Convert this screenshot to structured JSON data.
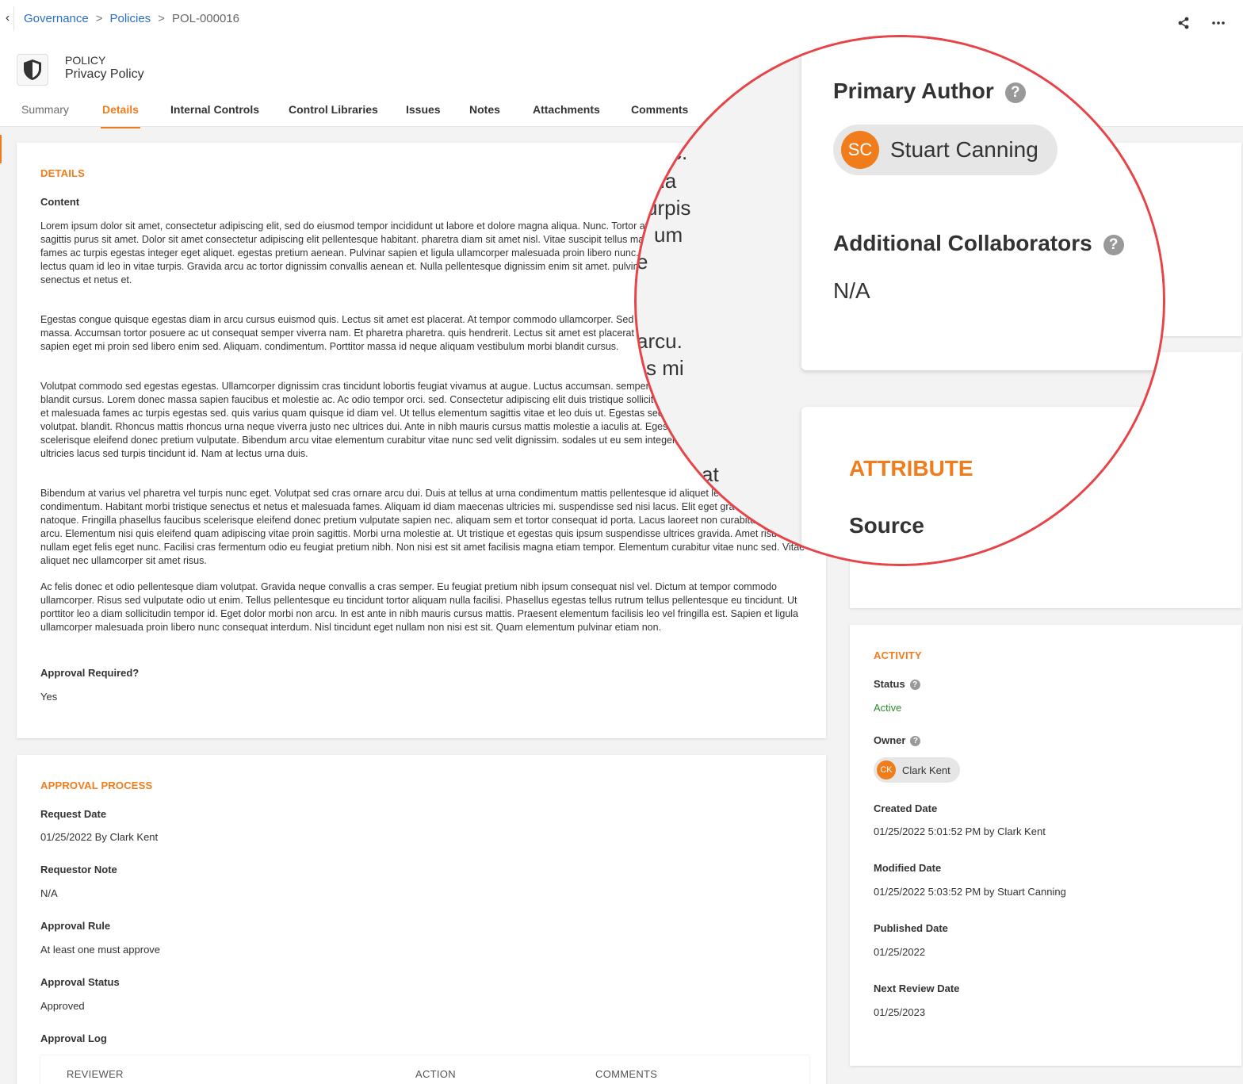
{
  "breadcrumb": {
    "item1": "Governance",
    "item2": "Policies",
    "current": "POL-000016"
  },
  "record": {
    "type": "POLICY",
    "name": "Privacy Policy"
  },
  "tabs": [
    "Summary",
    "Details",
    "Internal Controls",
    "Control Libraries",
    "Issues",
    "Notes",
    "Attachments",
    "Comments"
  ],
  "details": {
    "title": "DETAILS",
    "content_label": "Content",
    "paragraphs": [
      "Lorem ipsum dolor sit amet, consectetur adipiscing elit, sed do eiusmod tempor incididunt ut labore et dolore magna aliqua. Nunc. Tortor at risus viverra adipiscing at. Quisque sagittis purus sit amet. Dolor sit amet consectetur adipiscing elit pellentesque habitant. pharetra diam sit amet nisl. Vitae suscipit tellus mauris a diam maecenas. Malesuada fames ac turpis egestas integer eget aliquet. egestas pretium aenean. Pulvinar sapien et ligula ullamcorper malesuada proin libero nunc. Eu nisl nunc mi ipsum faucibus vitae. lectus quam id leo in vitae turpis. Gravida arcu ac tortor dignissim convallis aenean et. Nulla pellentesque dignissim enim sit amet. pulvinar pellentesque habitant morbi tristique senectus et netus et.",
      "Egestas congue quisque egestas diam in arcu cursus euismod quis. Lectus sit amet est placerat. At tempor commodo ullamcorper. Sed ullamcorper morbi tincidunt ornare massa. Accumsan tortor posuere ac ut consequat semper viverra nam. Et pharetra pharetra. quis hendrerit. Lectus sit amet est placerat in egestas erat imperdiet. Ultrices dui sapien eget mi proin sed libero enim sed. Aliquam. condimentum. Porttitor massa id neque aliquam vestibulum morbi blandit cursus.",
      "Volutpat commodo sed egestas egestas. Ullamcorper dignissim cras tincidunt lobortis feugiat vivamus at augue. Luctus accumsan. semper viverra. Aliquam vestibulum morbi blandit cursus. Lorem donec massa sapien faucibus et molestie ac. Ac odio tempor orci. sed. Consectetur adipiscing elit duis tristique sollicitudin nibh sit amet commodo. Netus et malesuada fames ac turpis egestas sed. quis varius quam quisque id diam vel. Ut tellus elementum sagittis vitae et leo duis ut. Egestas sed tempus urna et. Enim blandit volutpat. blandit. Rhoncus mattis rhoncus urna neque viverra justo nec ultrices dui. Ante in nibh mauris cursus mattis molestie a iaculis at. Egestas. phasellus faucibus scelerisque eleifend donec pretium vulputate. Bibendum arcu vitae elementum curabitur vitae nunc sed velit dignissim. sodales ut eu sem integer vitae justo. Placerat duis ultricies lacus sed turpis tincidunt id. Nam at lectus urna duis.",
      "Bibendum at varius vel pharetra vel turpis nunc eget. Volutpat sed cras ornare arcu dui. Duis at tellus at urna condimentum mattis pellentesque id aliquet lectus proin nibh nisl condimentum. Habitant morbi tristique senectus et netus et malesuada fames. Aliquam id diam maecenas ultricies mi. suspendisse sed nisi lacus. Elit eget gravida cum sociis natoque. Fringilla phasellus faucibus scelerisque eleifend donec pretium vulputate sapien nec. aliquam sem et tortor consequat id porta. Lacus laoreet non curabitur gravida arcu. Elementum nisi quis eleifend quam adipiscing vitae proin sagittis. Morbi urna molestie at. Ut tristique et egestas quis ipsum suspendisse ultrices gravida. Amet risus nullam eget felis eget nunc. Facilisi cras fermentum odio eu feugiat pretium nibh. Non nisi est sit amet facilisis magna etiam tempor. Elementum curabitur vitae nunc sed. Vitae aliquet nec ullamcorper sit amet risus.",
      "Ac felis donec et odio pellentesque diam volutpat. Gravida neque convallis a cras semper. Eu feugiat pretium nibh ipsum consequat nisl vel. Dictum at tempor commodo ullamcorper. Risus sed vulputate odio ut enim. Tellus pellentesque eu tincidunt tortor aliquam nulla facilisi. Phasellus egestas tellus rutrum tellus pellentesque eu tincidunt. Ut porttitor leo a diam sollicitudin tempor id. Eget dolor morbi non arcu. In est ante in nibh mauris cursus mattis. Praesent elementum facilisis leo vel fringilla est. Sapien et ligula ullamcorper malesuada proin libero nunc consequat interdum. Nisl tincidunt eget nullam non nisi est sit. Quam elementum pulvinar etiam non."
    ],
    "approval_required_label": "Approval Required?",
    "approval_required_value": "Yes"
  },
  "approval": {
    "title": "APPROVAL PROCESS",
    "request_date_label": "Request Date",
    "request_date_value": "01/25/2022 By Clark Kent",
    "requestor_note_label": "Requestor Note",
    "requestor_note_value": "N/A",
    "rule_label": "Approval Rule",
    "rule_value": "At least one must approve",
    "status_label": "Approval Status",
    "status_value": "Approved",
    "log_label": "Approval Log",
    "log_columns": [
      "REVIEWER",
      "ACTION",
      "COMMENTS"
    ]
  },
  "activity": {
    "title": "ACTIVITY",
    "status_label": "Status",
    "status_value": "Active",
    "owner_label": "Owner",
    "owner_initials": "CK",
    "owner_name": "Clark Kent",
    "created_label": "Created Date",
    "created_value": "01/25/2022 5:01:52 PM by Clark Kent",
    "modified_label": "Modified Date",
    "modified_value": "01/25/2022 5:03:52 PM by Stuart Canning",
    "published_label": "Published Date",
    "published_value": "01/25/2022",
    "next_review_label": "Next Review Date",
    "next_review_value": "01/25/2023"
  },
  "zoom": {
    "primary_author_label": "Primary Author",
    "author_initials": "SC",
    "author_name": "Stuart Canning",
    "collaborators_label": "Additional Collaborators",
    "collaborators_value": "N/A",
    "attribute_title": "ATTRIBUTE",
    "source_label": "Source",
    "text_fragments": [
      "c.",
      "ia",
      "urpis",
      "um",
      "e",
      "arcu.",
      "s mi",
      "at"
    ]
  },
  "colors": {
    "accent": "#f07c1b",
    "link": "#2a6fc4",
    "status_active": "#2e8b2e",
    "magnifier_ring": "#e74449"
  }
}
